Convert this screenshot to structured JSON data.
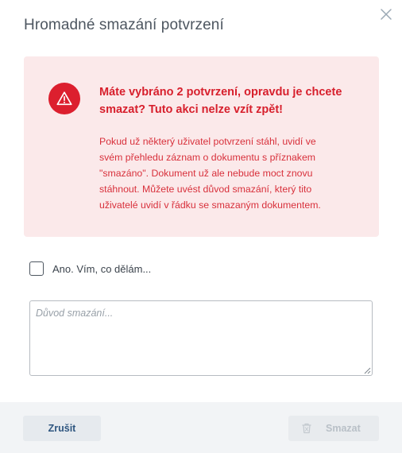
{
  "dialog": {
    "title": "Hromadné smazání potvrzení",
    "close_icon": "close-icon"
  },
  "alert": {
    "icon": "warning-triangle-icon",
    "heading": "Máte vybráno 2 potvrzení, opravdu je chcete smazat? Tuto akci nelze vzít zpět!",
    "body": "Pokud už některý uživatel potvrzení stáhl, uvidí ve svém přehledu záznam o dokumentu s příznakem \"smazáno\". Dokument už ale nebude moct znovu stáhnout. Můžete uvést důvod smazání, který tito uživatelé uvidí v řádku se smazaným dokumentem.",
    "color": "#dc1f2e",
    "background": "#fbe9ea"
  },
  "confirm": {
    "label": "Ano. Vím, co dělám...",
    "checked": false
  },
  "reason": {
    "placeholder": "Důvod smazání...",
    "value": ""
  },
  "footer": {
    "cancel_label": "Zrušit",
    "delete_label": "Smazat",
    "delete_icon": "trash-icon",
    "delete_disabled": true
  }
}
